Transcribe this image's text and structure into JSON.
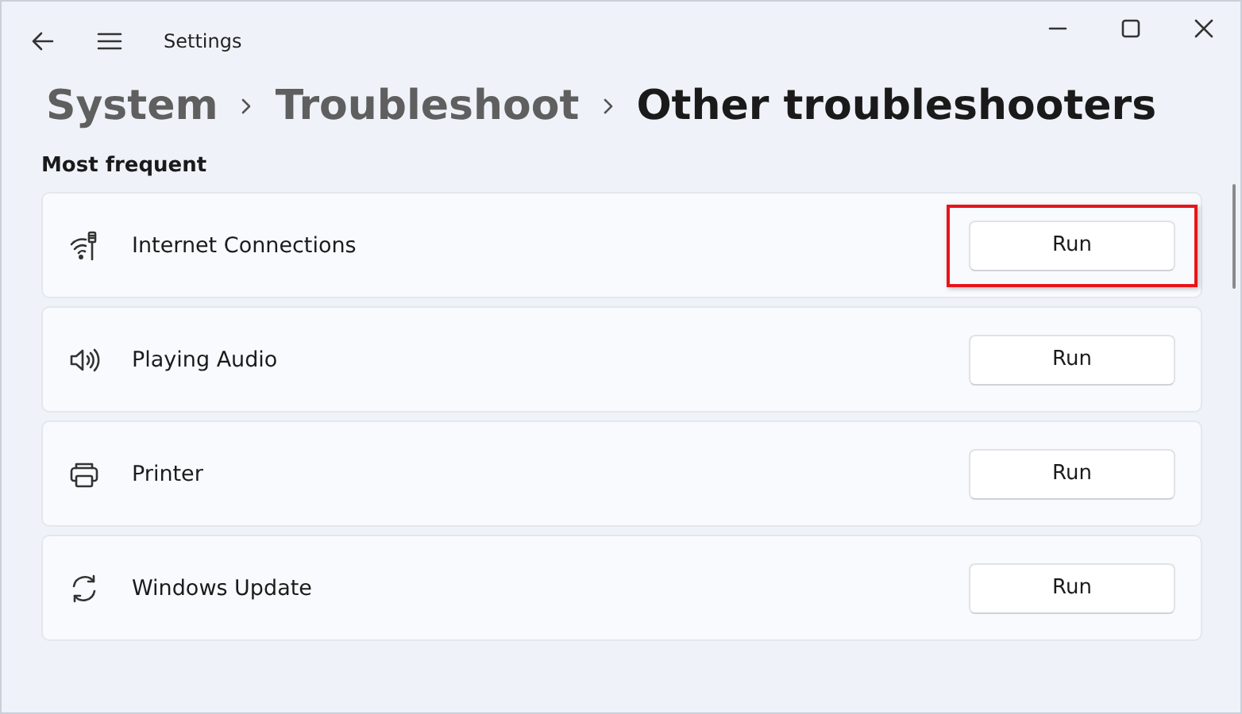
{
  "window": {
    "title": "Settings"
  },
  "breadcrumb": [
    {
      "label": "System",
      "current": false
    },
    {
      "label": "Troubleshoot",
      "current": false
    },
    {
      "label": "Other troubleshooters",
      "current": true
    }
  ],
  "section": {
    "title": "Most frequent"
  },
  "troubleshooters": [
    {
      "name": "Internet Connections",
      "button": "Run",
      "highlighted": true
    },
    {
      "name": "Playing Audio",
      "button": "Run",
      "highlighted": false
    },
    {
      "name": "Printer",
      "button": "Run",
      "highlighted": false
    },
    {
      "name": "Windows Update",
      "button": "Run",
      "highlighted": false
    }
  ]
}
